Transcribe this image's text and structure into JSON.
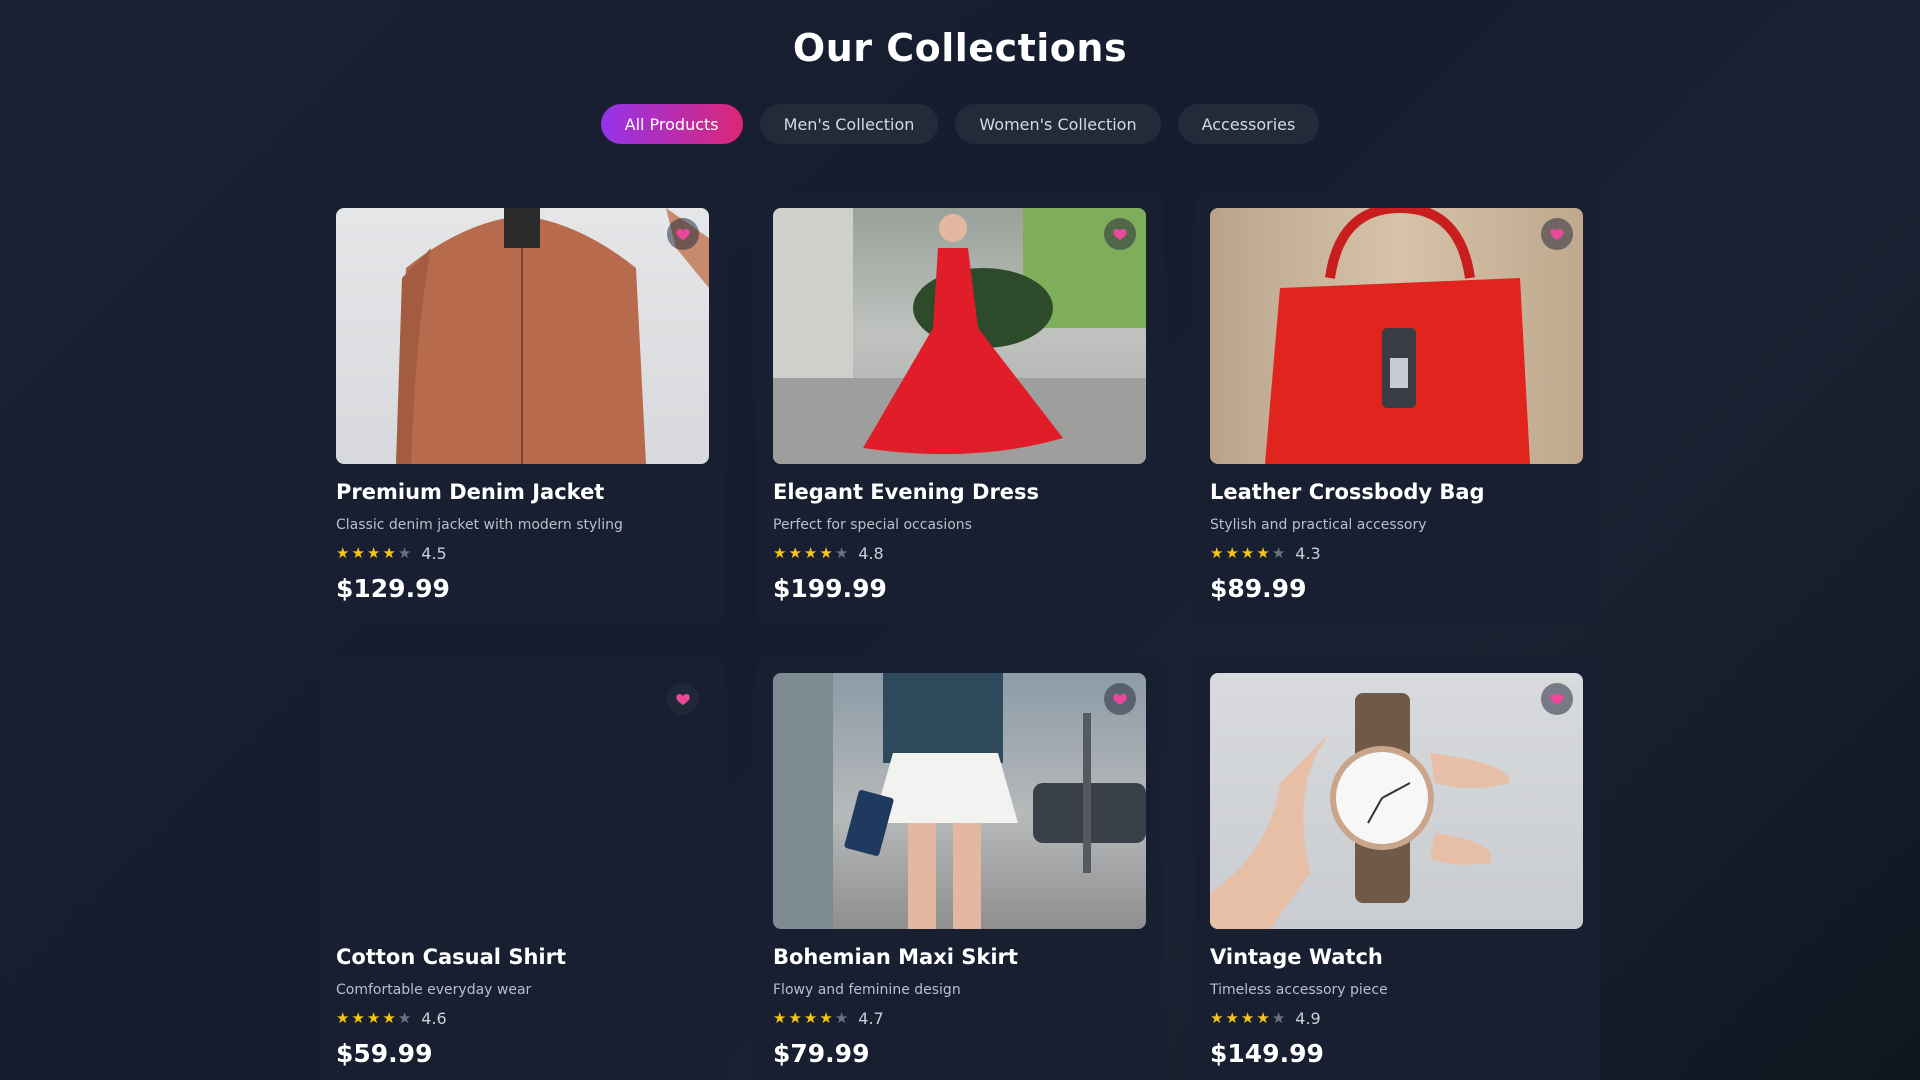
{
  "page": {
    "title": "Our Collections"
  },
  "filters": [
    {
      "label": "All Products",
      "active": true
    },
    {
      "label": "Men's Collection",
      "active": false
    },
    {
      "label": "Women's Collection",
      "active": false
    },
    {
      "label": "Accessories",
      "active": false
    }
  ],
  "colors": {
    "accent_start": "#9333ea",
    "accent_end": "#db2777",
    "heart": "#ec4899",
    "star": "#f5c518"
  },
  "products": [
    {
      "name": "Premium Denim Jacket",
      "description": "Classic denim jacket with modern styling",
      "rating": "4.5",
      "stars": 4,
      "price": "$129.99",
      "image": "orange-bomber-jacket-photo"
    },
    {
      "name": "Elegant Evening Dress",
      "description": "Perfect for special occasions",
      "rating": "4.8",
      "stars": 4,
      "price": "$199.99",
      "image": "woman-red-dress-photo"
    },
    {
      "name": "Leather Crossbody Bag",
      "description": "Stylish and practical accessory",
      "rating": "4.3",
      "stars": 4,
      "price": "$89.99",
      "image": "red-handbag-photo"
    },
    {
      "name": "Cotton Casual Shirt",
      "description": "Comfortable everyday wear",
      "rating": "4.6",
      "stars": 4,
      "price": "$59.99",
      "image": ""
    },
    {
      "name": "Bohemian Maxi Skirt",
      "description": "Flowy and feminine design",
      "rating": "4.7",
      "stars": 4,
      "price": "$79.99",
      "image": "woman-white-skirt-street-photo"
    },
    {
      "name": "Vintage Watch",
      "description": "Timeless accessory piece",
      "rating": "4.9",
      "stars": 4,
      "price": "$149.99",
      "image": "hand-holding-watch-photo"
    }
  ]
}
